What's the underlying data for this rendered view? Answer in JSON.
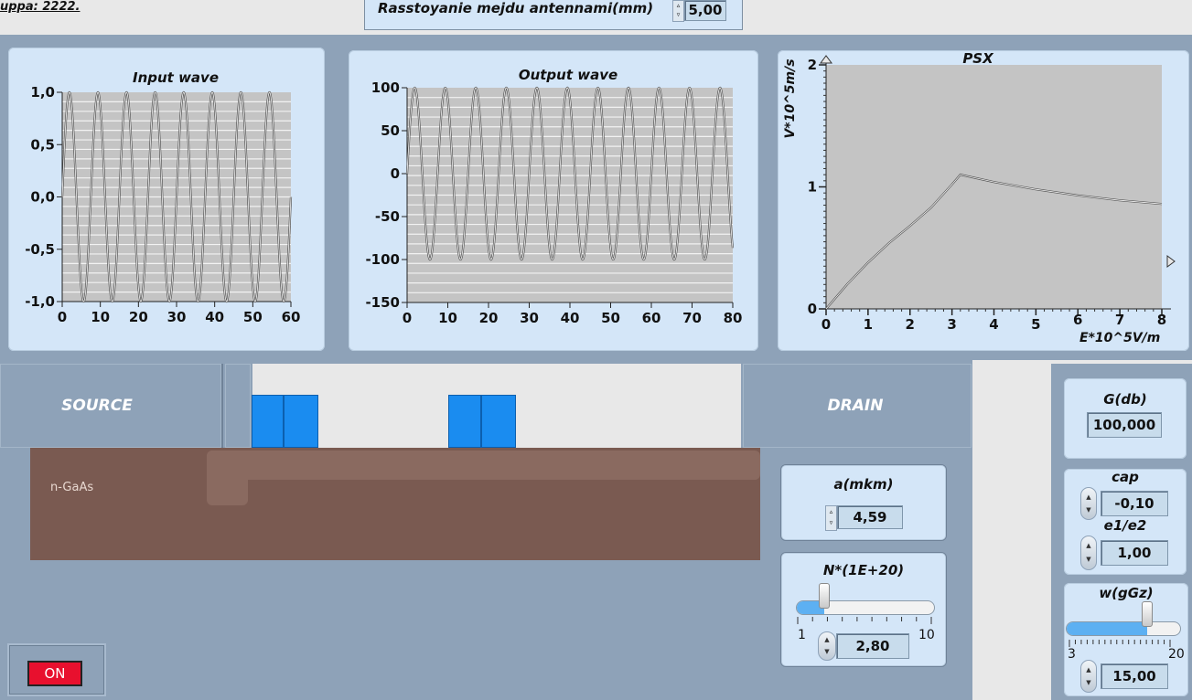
{
  "header": {
    "group_label": "uppa: 2222.",
    "distance_label": "Rasstoyanie mejdu antennami(mm)",
    "distance_value": "5,00"
  },
  "input_chart": {
    "title": "Input wave",
    "y_ticks": [
      "1,0",
      "0,5",
      "0,0",
      "-0,5",
      "-1,0"
    ],
    "x_ticks": [
      "0",
      "10",
      "20",
      "30",
      "40",
      "50",
      "60"
    ]
  },
  "output_chart": {
    "title": "Output wave",
    "y_ticks": [
      "100",
      "50",
      "0",
      "-50",
      "-100",
      "-150"
    ],
    "x_ticks": [
      "0",
      "10",
      "20",
      "30",
      "40",
      "50",
      "60",
      "70",
      "80"
    ]
  },
  "psx_chart": {
    "title": "PSX",
    "ylabel": "V*10^5m/s",
    "xlabel": "E*10^5V/m",
    "y_ticks": [
      "2",
      "1",
      "0"
    ],
    "x_ticks": [
      "0",
      "1",
      "2",
      "3",
      "4",
      "5",
      "6",
      "7",
      "8"
    ]
  },
  "chart_data": [
    {
      "type": "line",
      "title": "Input wave",
      "xlim": [
        0,
        60
      ],
      "ylim": [
        -1.0,
        1.0
      ],
      "period": 7.5,
      "amplitude": 1.0,
      "grid": true
    },
    {
      "type": "line",
      "title": "Output wave",
      "xlim": [
        0,
        80
      ],
      "ylim": [
        -150,
        100
      ],
      "period": 7.5,
      "amplitude": 100,
      "grid": true
    },
    {
      "type": "line",
      "title": "PSX",
      "xlabel": "E*10^5V/m",
      "ylabel": "V*10^5m/s",
      "xlim": [
        0,
        8
      ],
      "ylim": [
        0,
        2
      ],
      "x": [
        0,
        0.5,
        1,
        1.5,
        2,
        2.5,
        3,
        3.2,
        4,
        5,
        6,
        7,
        8
      ],
      "y": [
        0,
        0.2,
        0.38,
        0.54,
        0.68,
        0.83,
        1.02,
        1.1,
        1.04,
        0.98,
        0.93,
        0.89,
        0.86
      ],
      "grid": false
    }
  ],
  "device": {
    "source_label": "SOURCE",
    "drain_label": "DRAIN",
    "substrate_label": "n-GaAs",
    "substrate_color": "#7a5a51",
    "electrode_color": "#1a8cf0"
  },
  "controls": {
    "a_label": "a(mkm)",
    "a_value": "4,59",
    "n_label": "N*(1E+20)",
    "n_min": "1",
    "n_max": "10",
    "n_value": "2,80",
    "n_fill": 0.2,
    "g_label": "G(db)",
    "g_value": "100,000",
    "cap_label": "cap",
    "cap_value": "-0,10",
    "e_label": "e1/e2",
    "e_value": "1,00",
    "w_label": "w(gGz)",
    "w_min": "3",
    "w_max": "20",
    "w_value": "15,00",
    "w_fill": 0.706,
    "on_label": "ON",
    "on_color": "#e8102e"
  }
}
